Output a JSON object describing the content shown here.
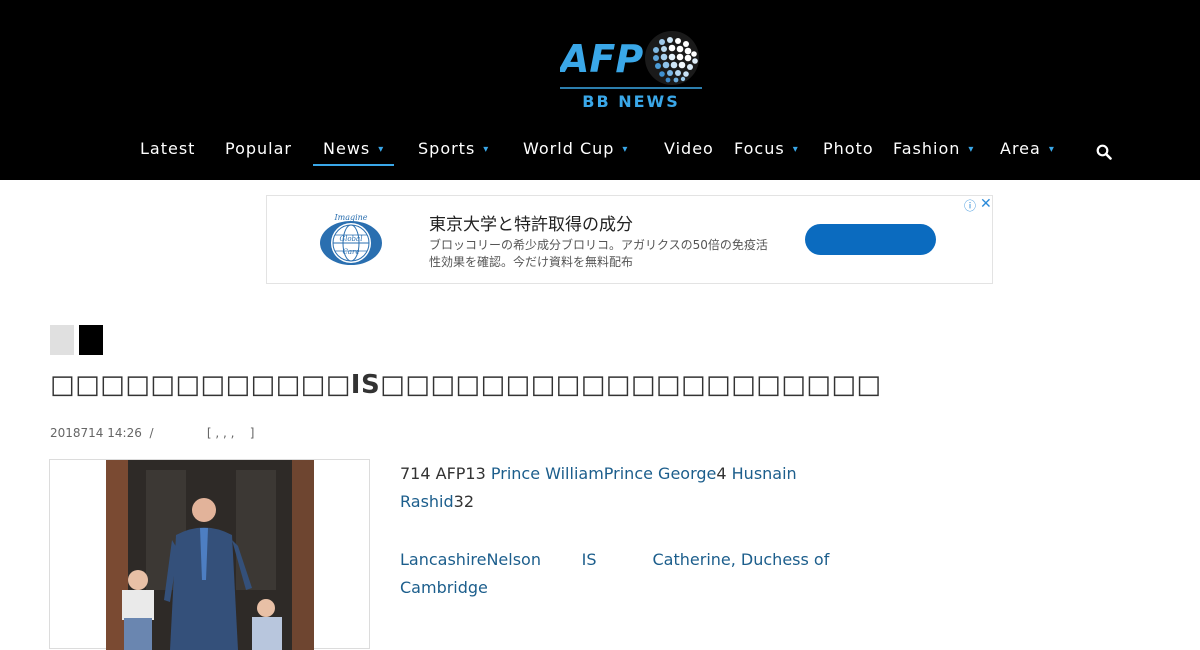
{
  "header": {
    "logo_brand": "AFP",
    "logo_subtitle": "BB NEWS",
    "nav": [
      {
        "label": "Latest",
        "dropdown": false
      },
      {
        "label": "Popular",
        "dropdown": false
      },
      {
        "label": "News",
        "dropdown": true,
        "active": true
      },
      {
        "label": "Sports",
        "dropdown": true
      },
      {
        "label": "World Cup",
        "dropdown": true
      },
      {
        "label": "Video",
        "dropdown": false
      },
      {
        "label": "Focus",
        "dropdown": true
      },
      {
        "label": "Photo",
        "dropdown": false
      },
      {
        "label": "Fashion",
        "dropdown": true
      },
      {
        "label": "Area",
        "dropdown": true
      }
    ],
    "caret": "▾",
    "search_icon": "search-icon"
  },
  "ad": {
    "logo_text_top": "Imagine",
    "logo_text_mid": "Global",
    "logo_text_bottom": "Care",
    "title": "東京大学と特許取得の成分",
    "description": "ブロッコリーの希少成分ブロリコ。アガリクスの50倍の免疫活性効果を確認。今だけ資料を無料配布",
    "info_icon": "ⓘ",
    "close_icon": "✕"
  },
  "article": {
    "title": "□□□□□□□□□□□□IS□□□□□□□□□□□□□□□□□□□□",
    "meta": "2018714 14:26  /              [ , , ,    ]",
    "p1": {
      "t1": "714 AFP13         ",
      "l1": "Prince William",
      "l2": "Prince George",
      "t2": "4      ",
      "l3": "Husnain Rashid",
      "t3": "32"
    },
    "p2": {
      "l1": "LancashireNelson",
      "t1": "        ",
      "l2": "IS",
      "t2": "           ",
      "l3": "Catherine, Duchess of Cambridge"
    }
  },
  "colors": {
    "header_bg": "#000000",
    "accent": "#3aa7e8",
    "link": "#1c5e8c",
    "ad_button": "#0b6bbf"
  }
}
